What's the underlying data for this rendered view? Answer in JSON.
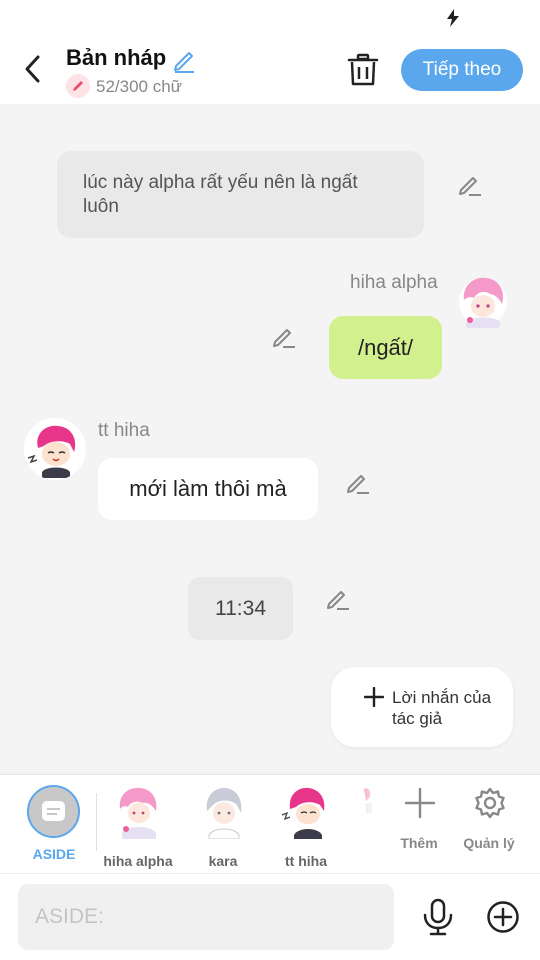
{
  "header": {
    "title": "Bản nháp",
    "word_count": "52/300 chữ",
    "next_label": "Tiếp theo"
  },
  "chat": {
    "narration": "lúc này alpha rất yếu nên là ngất luôn",
    "msg_right": {
      "sender": "hiha alpha",
      "text": "/ngất/"
    },
    "msg_left": {
      "sender": "tt hiha",
      "text": "mới làm thôi mà"
    },
    "time": "11:34",
    "author_note": "Lời nhắn của tác giả"
  },
  "characters": [
    {
      "name": "ASIDE",
      "selected": true
    },
    {
      "name": "hiha alpha"
    },
    {
      "name": "kara"
    },
    {
      "name": "tt hiha"
    }
  ],
  "tools": {
    "add_label": "Thêm",
    "manage_label": "Quản lý"
  },
  "input": {
    "placeholder": "ASIDE:"
  },
  "colors": {
    "accent": "#5aa7ee",
    "own_bubble": "#d2f08e",
    "chat_bg": "#f4f4f4"
  }
}
